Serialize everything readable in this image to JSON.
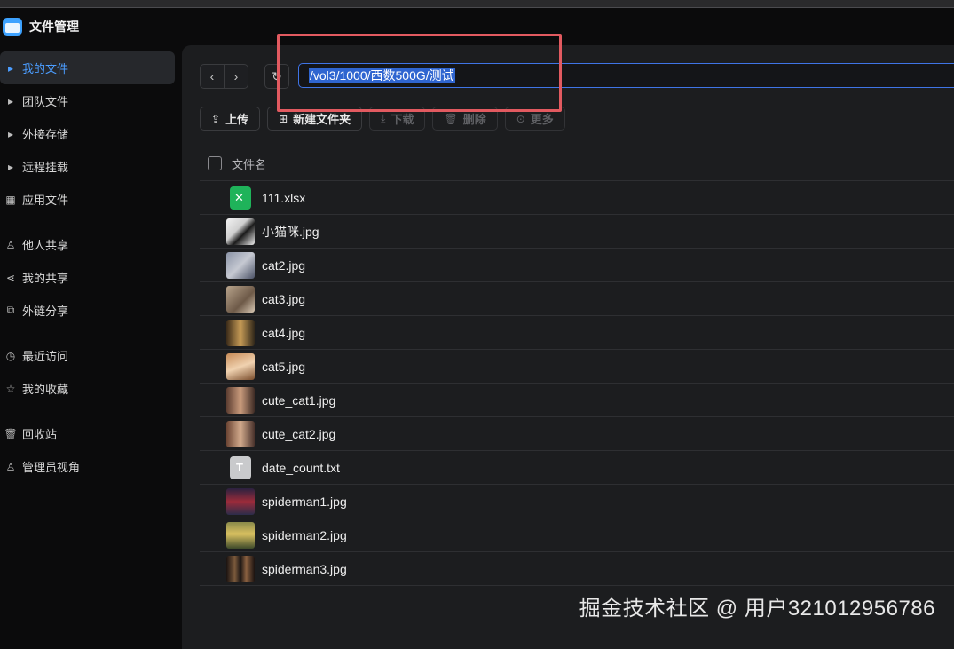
{
  "app": {
    "title": "文件管理"
  },
  "sidebar": {
    "items": [
      {
        "label": "我的文件",
        "icon": "caret-right-icon",
        "active": true
      },
      {
        "label": "团队文件",
        "icon": "caret-right-icon"
      },
      {
        "label": "外接存储",
        "icon": "caret-right-icon"
      },
      {
        "label": "远程挂载",
        "icon": "caret-right-icon"
      },
      {
        "label": "应用文件",
        "icon": "apps-grid-icon"
      },
      {
        "label": "他人共享",
        "icon": "user-share-icon"
      },
      {
        "label": "我的共享",
        "icon": "share-icon"
      },
      {
        "label": "外链分享",
        "icon": "external-link-icon"
      },
      {
        "label": "最近访问",
        "icon": "clock-icon"
      },
      {
        "label": "我的收藏",
        "icon": "star-icon"
      },
      {
        "label": "回收站",
        "icon": "trash-icon"
      },
      {
        "label": "管理员视角",
        "icon": "admin-user-icon"
      }
    ]
  },
  "path_bar": {
    "value": "/vol3/1000/西数500G/测试"
  },
  "toolbar": {
    "upload": "上传",
    "new_folder": "新建文件夹",
    "download": "下载",
    "delete": "删除",
    "more": "更多"
  },
  "table": {
    "header_name": "文件名",
    "rows": [
      {
        "name": "111.xlsx",
        "type": "xlsx"
      },
      {
        "name": "小猫咪.jpg",
        "type": "image"
      },
      {
        "name": "cat2.jpg",
        "type": "image"
      },
      {
        "name": "cat3.jpg",
        "type": "image"
      },
      {
        "name": "cat4.jpg",
        "type": "image"
      },
      {
        "name": "cat5.jpg",
        "type": "image"
      },
      {
        "name": "cute_cat1.jpg",
        "type": "image"
      },
      {
        "name": "cute_cat2.jpg",
        "type": "image"
      },
      {
        "name": "date_count.txt",
        "type": "txt"
      },
      {
        "name": "spiderman1.jpg",
        "type": "image"
      },
      {
        "name": "spiderman2.jpg",
        "type": "image"
      },
      {
        "name": "spiderman3.jpg",
        "type": "image"
      }
    ]
  },
  "watermark": "掘金技术社区 @ 用户321012956786",
  "colors": {
    "accent": "#4b9dff",
    "highlight_box": "#e25a60",
    "selection": "#2f65d0"
  }
}
